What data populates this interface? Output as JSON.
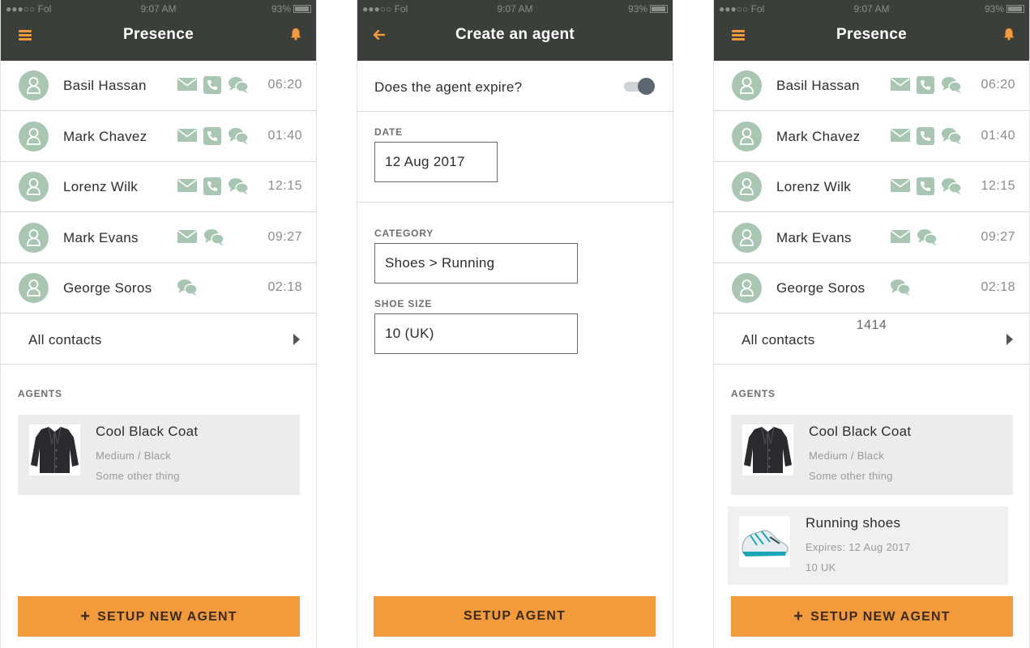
{
  "status": {
    "carrier": "●●●○○ Fol",
    "time": "9:07 AM",
    "battery": "93%"
  },
  "screen1": {
    "title": "Presence",
    "contacts": [
      {
        "name": "Basil Hassan",
        "time": "06:20",
        "icons": [
          "mail",
          "phone",
          "chat"
        ]
      },
      {
        "name": "Mark Chavez",
        "time": "01:40",
        "icons": [
          "mail",
          "phone",
          "chat"
        ]
      },
      {
        "name": "Lorenz Wilk",
        "time": "12:15",
        "icons": [
          "mail",
          "phone",
          "chat"
        ]
      },
      {
        "name": "Mark Evans",
        "time": "09:27",
        "icons": [
          "mail",
          "chat"
        ]
      },
      {
        "name": "George Soros",
        "time": "02:18",
        "icons": [
          "chat"
        ]
      }
    ],
    "all_contacts": "All contacts",
    "agents_label": "AGENTS",
    "agents": [
      {
        "title": "Cool Black Coat",
        "line1": "Medium / Black",
        "line2": "Some other thing",
        "image": "coat"
      }
    ],
    "button": "SETUP NEW AGENT"
  },
  "screen2": {
    "title": "Create an agent",
    "expire_label": "Does the agent expire?",
    "expire_on": true,
    "date_label": "DATE",
    "date_value": "12 Aug 2017",
    "category_label": "CATEGORY",
    "category_value": "Shoes > Running",
    "shoe_size_label": "SHOE SIZE",
    "shoe_size_value": "10 (UK)",
    "button": "SETUP AGENT"
  },
  "screen3": {
    "title": "Presence",
    "overlay_text": "1414",
    "contacts": [
      {
        "name": "Basil Hassan",
        "time": "06:20",
        "icons": [
          "mail",
          "phone",
          "chat"
        ]
      },
      {
        "name": "Mark Chavez",
        "time": "01:40",
        "icons": [
          "mail",
          "phone",
          "chat"
        ]
      },
      {
        "name": "Lorenz Wilk",
        "time": "12:15",
        "icons": [
          "mail",
          "phone",
          "chat"
        ]
      },
      {
        "name": "Mark Evans",
        "time": "09:27",
        "icons": [
          "mail",
          "chat"
        ]
      },
      {
        "name": "George Soros",
        "time": "02:18",
        "icons": [
          "chat"
        ]
      }
    ],
    "all_contacts": "All contacts",
    "agents_label": "AGENTS",
    "agents": [
      {
        "title": "Cool Black Coat",
        "line1": "Medium / Black",
        "line2": "Some other thing",
        "image": "coat"
      },
      {
        "title": "Running shoes",
        "line1": "Expires: 12 Aug 2017",
        "line2": "10 UK",
        "image": "shoe"
      }
    ],
    "button": "SETUP NEW AGENT"
  },
  "colors": {
    "accent": "#f39a3c",
    "header": "#3b3f3a",
    "icon_green": "#a8c6b2"
  }
}
